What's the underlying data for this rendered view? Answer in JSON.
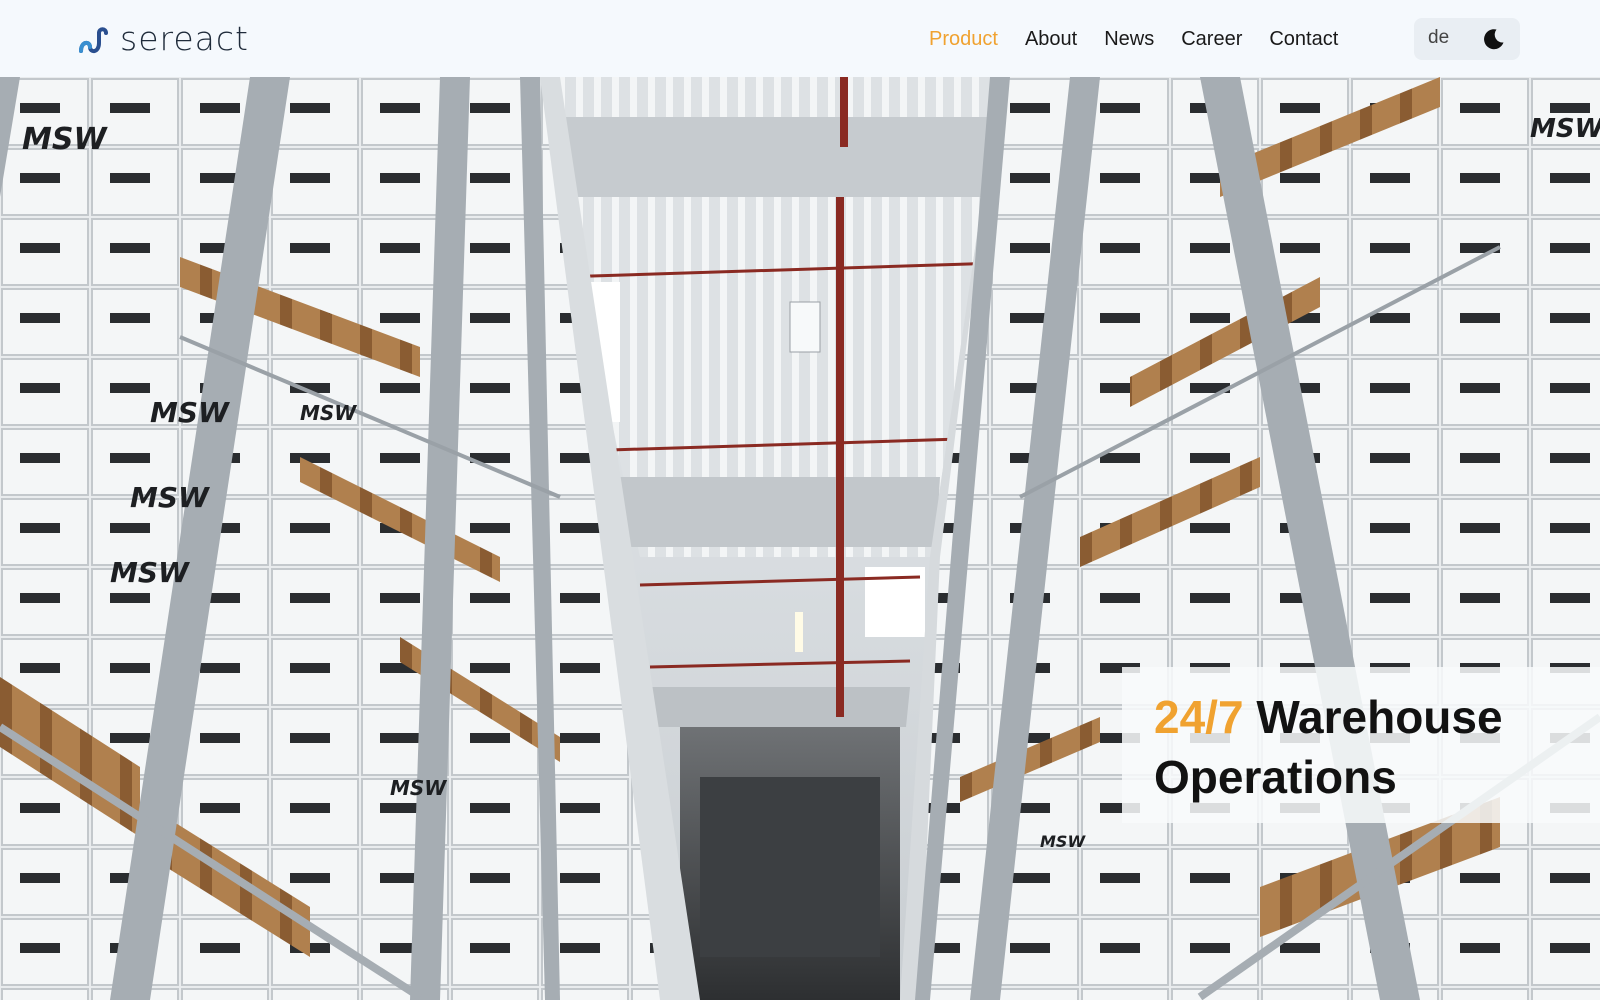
{
  "brand": {
    "name": "sereact",
    "logo_icon": "sereact-swirl-icon"
  },
  "nav": {
    "items": [
      {
        "label": "Product",
        "active": true
      },
      {
        "label": "About",
        "active": false
      },
      {
        "label": "News",
        "active": false
      },
      {
        "label": "Career",
        "active": false
      },
      {
        "label": "Contact",
        "active": false
      }
    ]
  },
  "controls": {
    "language": "de",
    "theme_icon": "moon-icon"
  },
  "hero": {
    "image_subject": "warehouse-aisle-with-pallet-racks",
    "box_marking": "MSW",
    "headline_accent": "24/7",
    "headline_rest": "Warehouse",
    "headline_line2": "Operations"
  },
  "colors": {
    "accent": "#f0a230",
    "header_bg": "#f5f9fd",
    "text_dark": "#121212"
  }
}
